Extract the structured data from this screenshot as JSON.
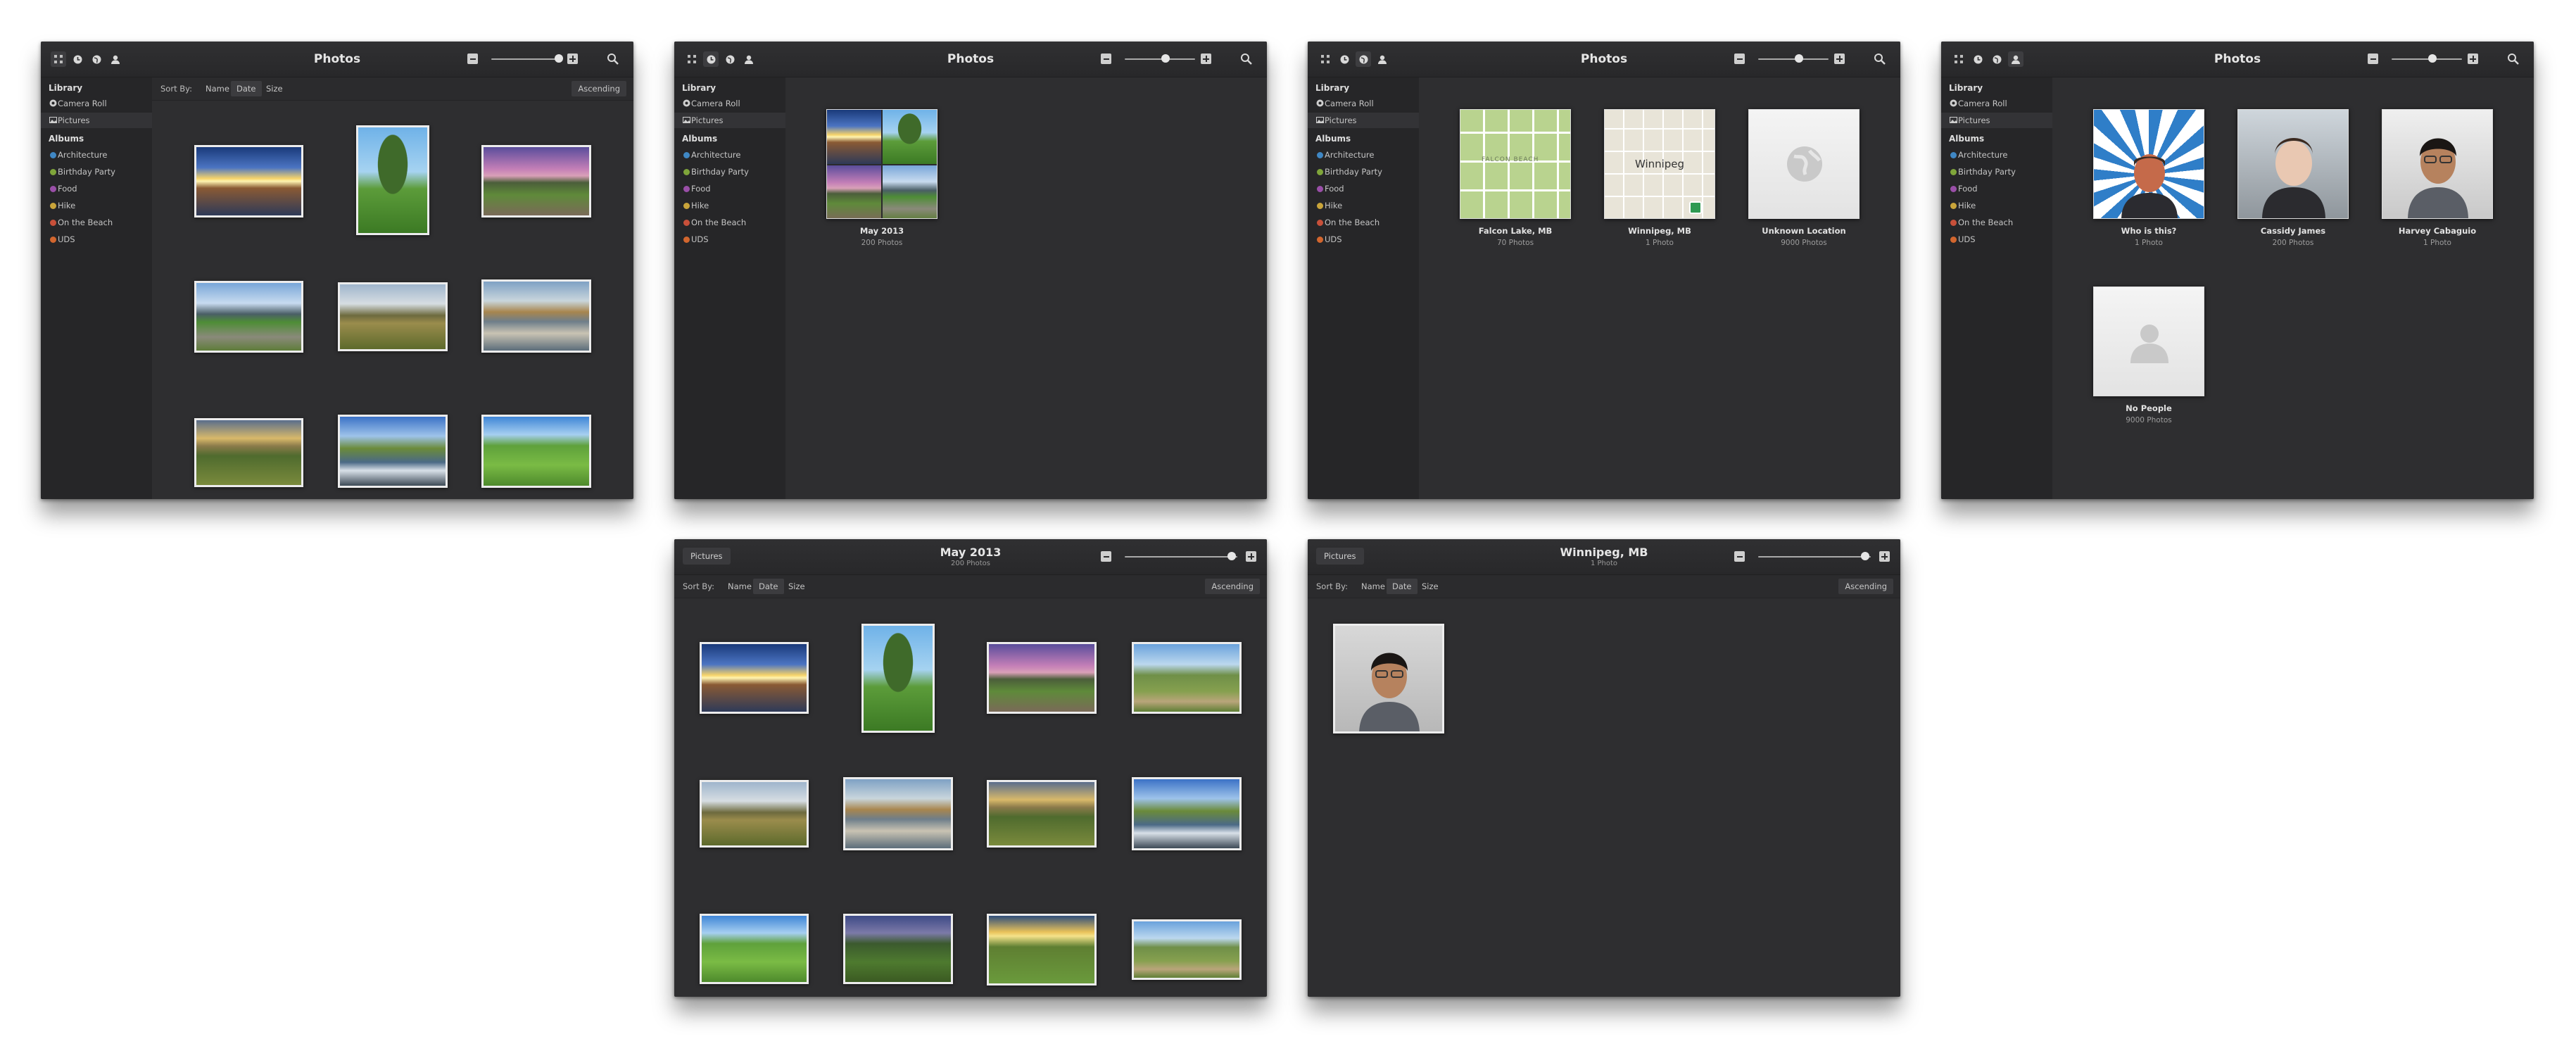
{
  "app": {
    "title": "Photos"
  },
  "sidebar": {
    "library_header": "Library",
    "library_items": [
      {
        "label": "Camera Roll",
        "icon": "camera-roll-icon"
      },
      {
        "label": "Pictures",
        "icon": "pictures-icon"
      }
    ],
    "albums_header": "Albums",
    "albums": [
      {
        "label": "Architecture",
        "color": "#3f87c4"
      },
      {
        "label": "Birthday Party",
        "color": "#7fa53a"
      },
      {
        "label": "Food",
        "color": "#9a4fa8"
      },
      {
        "label": "Hike",
        "color": "#c9a43a"
      },
      {
        "label": "On the Beach",
        "color": "#c8503a"
      },
      {
        "label": "UDS",
        "color": "#d2662e"
      }
    ]
  },
  "sort": {
    "label": "Sort By:",
    "options": [
      "Name",
      "Date",
      "Size"
    ],
    "active": "Date",
    "order": "Ascending"
  },
  "toolbar": {
    "view_modes": [
      "grid-icon",
      "clock-icon",
      "globe-icon",
      "person-icon"
    ],
    "zoom_out_icon": "minus-icon",
    "zoom_in_icon": "plus-icon",
    "search_icon": "search-icon"
  },
  "events_view": {
    "tiles": [
      {
        "label": "May 2013",
        "sub": "200 Photos"
      }
    ]
  },
  "places_view": {
    "tiles": [
      {
        "label": "Falcon Lake, MB",
        "sub": "70 Photos",
        "map_text": "FALCON BEACH"
      },
      {
        "label": "Winnipeg, MB",
        "sub": "1 Photo",
        "map_text": "Winnipeg"
      },
      {
        "label": "Unknown Location",
        "sub": "9000 Photos"
      }
    ]
  },
  "people_view": {
    "tiles": [
      {
        "label": "Who is this?",
        "sub": "1 Photo"
      },
      {
        "label": "Cassidy James",
        "sub": "200 Photos"
      },
      {
        "label": "Harvey Cabaguio",
        "sub": "1 Photo"
      },
      {
        "label": "No People",
        "sub": "9000 Photos"
      }
    ]
  },
  "event_detail": {
    "back": "Pictures",
    "title": "May 2013",
    "subtitle": "200 Photos"
  },
  "place_detail": {
    "back": "Pictures",
    "title": "Winnipeg, MB",
    "subtitle": "1 Photo"
  }
}
